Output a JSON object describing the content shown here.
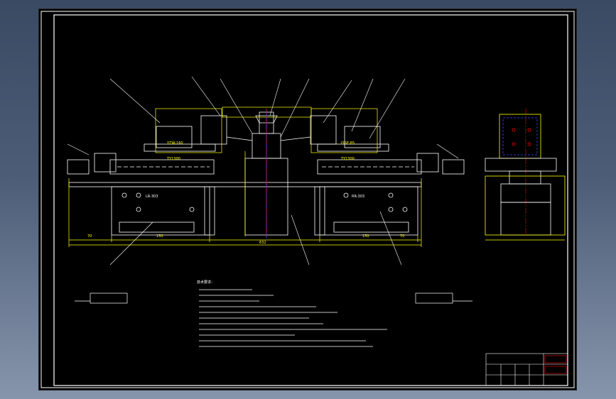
{
  "drawing": {
    "background_color": "#000000",
    "frame_color": "#ffffff",
    "part_color": "#ffffff",
    "dimension_color": "#ffff00",
    "leader_color": "#ffffff",
    "centerline_color": "#ff0000",
    "axis_color": "#0000ff",
    "title_block_accent": "#ff0000",
    "labels": {
      "left_motor_model": "YZW-160",
      "right_motor_model": "ISSE-85",
      "left_base_code": "LR-303",
      "right_base_code": "RR-303",
      "overall_dim": "632",
      "dim_left": "70",
      "dim_right": "70",
      "dim_mid_left": "150",
      "dim_mid_right": "150",
      "rail_left": "TY1300",
      "rail_right": "TY1300"
    },
    "notes_title": "技术要求："
  }
}
